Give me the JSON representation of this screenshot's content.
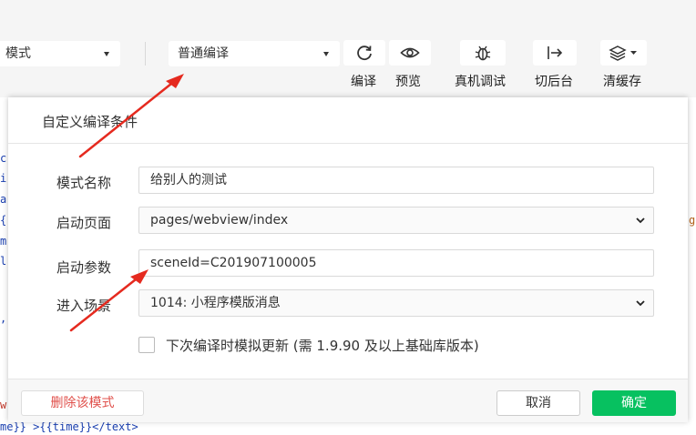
{
  "toolbar": {
    "mode_select": {
      "value": "模式"
    },
    "compile_select": {
      "value": "普通编译"
    },
    "buttons": {
      "compile": "编译",
      "preview": "预览",
      "remote_debug": "真机调试",
      "background": "切后台",
      "clear_cache": "清缓存"
    }
  },
  "editor": {
    "left_chars": [
      "c",
      "i",
      "a",
      "{",
      "m",
      "l",
      ","
    ],
    "right_char": "g",
    "left_bottom_chars": [
      "w"
    ],
    "bottom_line": "me}} >{{time}}</text>"
  },
  "modal": {
    "title": "自定义编译条件",
    "mode_name": {
      "label": "模式名称",
      "value": "给别人的测试"
    },
    "start_page": {
      "label": "启动页面",
      "value": "pages/webview/index"
    },
    "start_params": {
      "label": "启动参数",
      "value": "sceneId=C201907100005"
    },
    "scene": {
      "label": "进入场景",
      "value": "1014: 小程序模版消息"
    },
    "simulate_update": {
      "label": "下次编译时模拟更新 (需 1.9.90 及以上基础库版本)",
      "checked": false
    },
    "footer": {
      "delete": "删除该模式",
      "cancel": "取消",
      "confirm": "确定"
    }
  },
  "colors": {
    "primary_green": "#07c160",
    "danger_red": "#e0504b",
    "annotation_red": "#e52a1f",
    "code_blue": "#1a3fb0"
  }
}
